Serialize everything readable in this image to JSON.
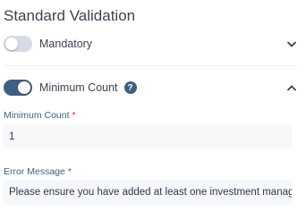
{
  "section": {
    "title": "Standard Validation"
  },
  "validations": [
    {
      "label": "Mandatory",
      "enabled": false,
      "expanded": false
    },
    {
      "label": "Minimum Count",
      "enabled": true,
      "expanded": true,
      "help_glyph": "?"
    }
  ],
  "fields": {
    "minimum_count": {
      "label": "Minimum Count",
      "required_marker": "*",
      "value": "1"
    },
    "error_message": {
      "label": "Error Message",
      "required_marker": "*",
      "value": "Please ensure you have added at least one investment manager"
    }
  },
  "icons": {
    "expand": "chevron-down-icon",
    "collapse": "chevron-up-icon",
    "help": "help-icon"
  },
  "colors": {
    "accent": "#3f5f80",
    "toggle_off": "#d5dbe3",
    "required": "#e0263a",
    "field_bg": "#f6f7f9"
  }
}
